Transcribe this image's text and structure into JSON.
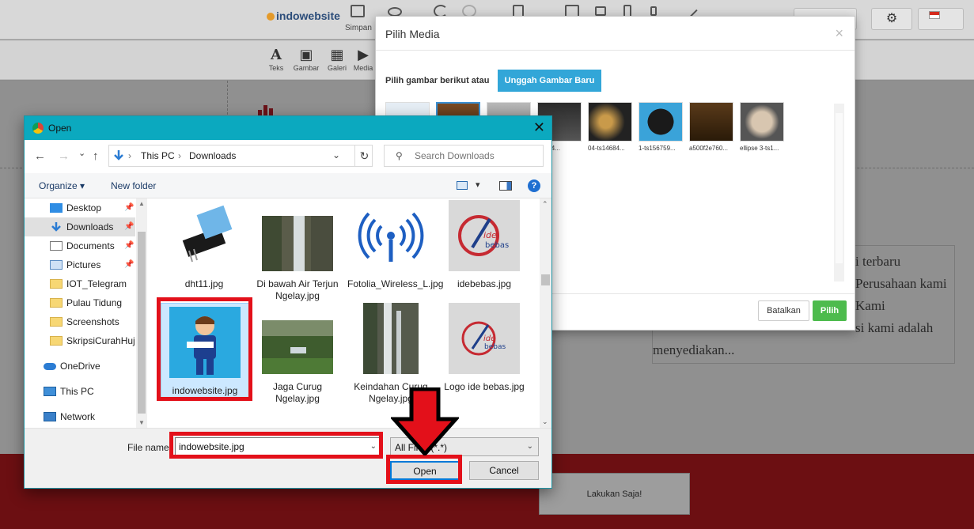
{
  "app": {
    "brand": "indowebsite",
    "save_label": "Simpan"
  },
  "toolbar": [
    {
      "glyph": "A",
      "label": "Teks"
    },
    {
      "glyph": "▣",
      "label": "Gambar"
    },
    {
      "glyph": "▦",
      "label": "Galeri"
    },
    {
      "glyph": "▶",
      "label": "Media"
    }
  ],
  "page": {
    "text_lines": [
      "i terbaru",
      "Perusahaan kami",
      "Kami",
      "si kami adalah",
      "menyediakan..."
    ],
    "cta_label": "Lakukan Saja!"
  },
  "media_modal": {
    "title": "Pilih Media",
    "close": "×",
    "prompt": "Pilih gambar berikut atau",
    "upload_label": "Unggah Gambar Baru",
    "thumb_captions": [
      "",
      "",
      "",
      "14684...",
      "04-ts14684...",
      "1-ts156759...",
      "a500f2e760...",
      "ellipse 3-ts1..."
    ],
    "cancel_label": "Batalkan",
    "ok_label": "Pilih"
  },
  "open_dialog": {
    "title": "Open",
    "close": "✕",
    "nav": {
      "back": "←",
      "forward": "→",
      "up": "↑",
      "recent": "⌄"
    },
    "breadcrumb": [
      "This PC",
      "Downloads"
    ],
    "refresh": "↻",
    "search_placeholder": "Search Downloads",
    "organize_label": "Organize ▾",
    "new_folder_label": "New folder",
    "help": "?",
    "sidebar": [
      {
        "label": "Desktop",
        "icon": "desktop-icon",
        "pinned": true
      },
      {
        "label": "Downloads",
        "icon": "downloads-icon",
        "pinned": true,
        "selected": true
      },
      {
        "label": "Documents",
        "icon": "documents-icon",
        "pinned": true
      },
      {
        "label": "Pictures",
        "icon": "pictures-icon",
        "pinned": true
      },
      {
        "label": "IOT_Telegram",
        "icon": "folder-icon"
      },
      {
        "label": "Pulau Tidung",
        "icon": "folder-icon"
      },
      {
        "label": "Screenshots",
        "icon": "folder-icon"
      },
      {
        "label": "SkripsiCurahHujan",
        "icon": "folder-icon"
      },
      {
        "label": "OneDrive",
        "icon": "onedrive-icon"
      },
      {
        "label": "This PC",
        "icon": "this-pc-icon"
      },
      {
        "label": "Network",
        "icon": "network-icon"
      }
    ],
    "files": [
      {
        "name": "dht11.jpg",
        "kind": "sensor"
      },
      {
        "name": "Di bawah Air Terjun Ngelay.jpg",
        "kind": "waterfall"
      },
      {
        "name": "Fotolia_Wireless_L.jpg",
        "kind": "wireless"
      },
      {
        "name": "idebebas.jpg",
        "kind": "idebebas"
      },
      {
        "name": "indowebsite.jpg",
        "kind": "mascot",
        "selected": true
      },
      {
        "name": "Jaga Curug Ngelay.jpg",
        "kind": "forest"
      },
      {
        "name": "Keindahan Curug Ngelay.jpg",
        "kind": "waterfall2"
      },
      {
        "name": "Logo ide bebas.jpg",
        "kind": "idebebas"
      }
    ],
    "file_name_label": "File name:",
    "file_name_value": "indowebsite.jpg",
    "file_type_value": "All Files (*.*)",
    "open_label": "Open",
    "cancel_label": "Cancel"
  },
  "colors": {
    "title_bar": "#0ba9bf",
    "highlight": "#e3101a",
    "upload_button": "#32a6d8",
    "ok_button": "#4dbb4d",
    "footer": "#6c0f12"
  }
}
